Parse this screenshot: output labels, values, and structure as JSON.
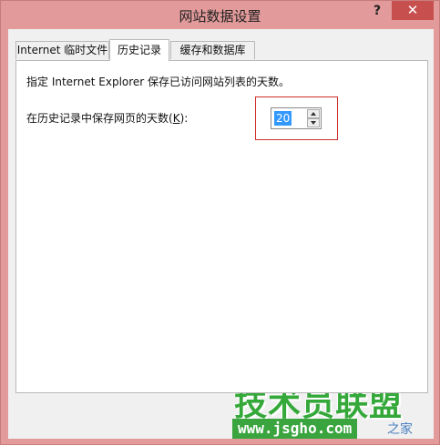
{
  "window": {
    "title": "网站数据设置",
    "help_label": "?",
    "close_label": "✕"
  },
  "tabs": [
    {
      "label": "Internet 临时文件",
      "active": false
    },
    {
      "label": "历史记录",
      "active": true
    },
    {
      "label": "缓存和数据库",
      "active": false
    }
  ],
  "history": {
    "description": "指定 Internet Explorer 保存已访问网站列表的天数。",
    "days_label_prefix": "在历史记录中保存网页的天数(",
    "days_label_accel": "K",
    "days_label_suffix": "):",
    "days_value": "20"
  },
  "watermark": {
    "main_text": "技术员联盟",
    "url_text": "www.jsgho.com",
    "suffix_text": "之家"
  }
}
